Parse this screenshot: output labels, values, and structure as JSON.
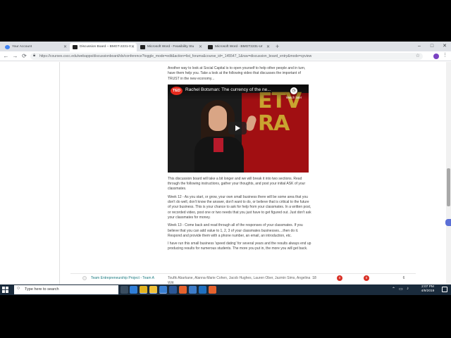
{
  "browser": {
    "tabs": [
      {
        "label": "Your Account",
        "active": false,
        "favicon_color": "#4285f4"
      },
      {
        "label": "Discussion Board – BMGT-2231-0",
        "active": true,
        "favicon_color": "#222222"
      },
      {
        "label": "Microsoft Word - Feasibility Stu",
        "active": false,
        "favicon_color": "#222222"
      },
      {
        "label": "Microsoft Word - BMGT2231-Ur",
        "active": false,
        "favicon_color": "#222222"
      }
    ],
    "new_tab": "+",
    "window_controls": {
      "minimize": "–",
      "maximize": "□",
      "close": "✕"
    },
    "nav": {
      "back": "←",
      "forward": "→",
      "reload": "⟳"
    },
    "url": "https://courses.cscc.edu/webapps/discussionboard/do/conference?toggle_mode=edit&action=list_forums&course_id=_145547_1&nav=discussion_board_entry&mode=cpview",
    "star": "☆",
    "menu": "⋮",
    "extension_colors": [
      "#7a42c2"
    ]
  },
  "post": {
    "intro": "Another way to look at Social Capital is to open yourself to help other people and in turn, have them help you.  Take a look at the following video that discusses the important of TRUST in the new economy...",
    "video": {
      "ted_label": "TED",
      "title": "Rachel Botsman: The currency of the ne...",
      "watch_later": "Watch later",
      "backdrop_text": "ETV\nRA",
      "ted_color": "#e62b1e"
    },
    "paragraphs": [
      "This discussion board will take a bit longer and we will break it into two sections.  Read through the following instructions, gather your thoughts, and post your initial ASK of your classmates.",
      "Week 12 - As you start, or grow, your own small business there will be some area that you don't do well, don't know the answer, don't want to do, or believe that is critical to the future of your business.  This is your chance to ask for help from your classmates.  In a written post, or recorded video, post one or two needs that you just have to get figured out.  Just don't ask your classmates for money.",
      "Week 13 - Come back and read through all of the responses of your classmates.  If you believe that you can add value to 1, 2, 3 of your classmates businesses....then do it.  Respond and provide them with a phone number, an email, an introduction, etc.",
      "I have run this small business 'speed dating' for several years and the results always end up producing results for numerous students.  The more you put in, the more you will get back."
    ]
  },
  "forum_row": {
    "title": "Team Entrepreneurship Project - Team A",
    "members": "Toufik Abarkane, Alanna-Marie Cohen, Jacob Hughes, Lauren Ober, Jazmin Sims, Angelina Witt",
    "total_posts": "18",
    "unread_posts": "0",
    "replies_to_me": "0",
    "participants": "6",
    "badge_color": "#d93025"
  },
  "taskbar": {
    "search_placeholder": "Type here to search",
    "search_icon": "○",
    "apps": [
      {
        "name": "task-view-icon",
        "color": "#3a4d60"
      },
      {
        "name": "edge-icon",
        "color": "#2f7ed8"
      },
      {
        "name": "chrome-icon",
        "color": "#e1b320"
      },
      {
        "name": "file-explorer-icon",
        "color": "#f0c23a"
      },
      {
        "name": "store-icon",
        "color": "#3a7fd0"
      },
      {
        "name": "word-icon",
        "color": "#2b5797"
      },
      {
        "name": "firefox-icon",
        "color": "#e6622d"
      },
      {
        "name": "mail-icon",
        "color": "#3d7cc9"
      },
      {
        "name": "edge-legacy-icon",
        "color": "#1f6fbf"
      },
      {
        "name": "firefox-icon-2",
        "color": "#e6622d"
      },
      {
        "name": "powerpoint-icon",
        "color": "#cf4a26"
      },
      {
        "name": "folder-icon",
        "color": "#c9842d"
      }
    ],
    "tray_symbols": [
      "⌃",
      "▭",
      "♪"
    ],
    "time": "2:07 PM",
    "date": "4/9/2019"
  }
}
